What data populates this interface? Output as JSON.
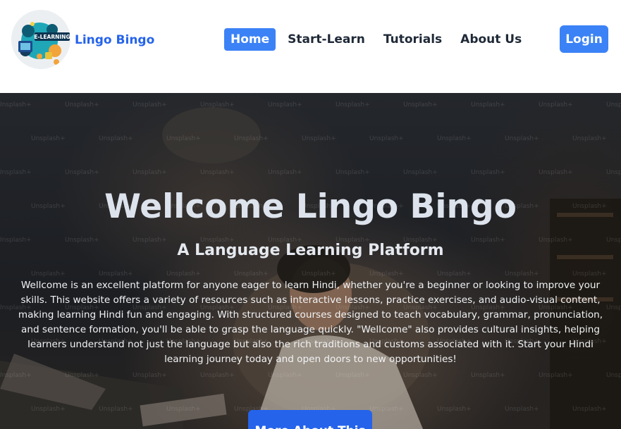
{
  "header": {
    "brand_name": "Lingo Bingo",
    "logo_text": "E-LEARNING",
    "nav": [
      {
        "label": "Home",
        "active": true
      },
      {
        "label": "Start-Learn",
        "active": false
      },
      {
        "label": "Tutorials",
        "active": false
      },
      {
        "label": "About Us",
        "active": false
      }
    ],
    "login_label": "Login"
  },
  "hero": {
    "title": "Wellcome Lingo Bingo",
    "subtitle": "A Language Learning Platform",
    "description": "Wellcome is an excellent platform for anyone eager to learn Hindi, whether you're a beginner or looking to improve your skills. This website offers a variety of resources such as interactive lessons, practice exercises, and audio-visual content, making learning Hindi fun and engaging. With structured courses designed to teach vocabulary, grammar, pronunciation, and sentence formation, you'll be able to grasp the language quickly. \"Wellcome\" also provides cultural insights, helping learners understand not just the language but also the rich traditions and customs associated with it. Start your Hindi learning journey today and open doors to new opportunities!",
    "button_label": "More About This",
    "watermark_text": "Unsplash+"
  },
  "colors": {
    "accent": "#3b82f6",
    "brand_text": "#2563eb",
    "nav_text": "#1f2937"
  }
}
